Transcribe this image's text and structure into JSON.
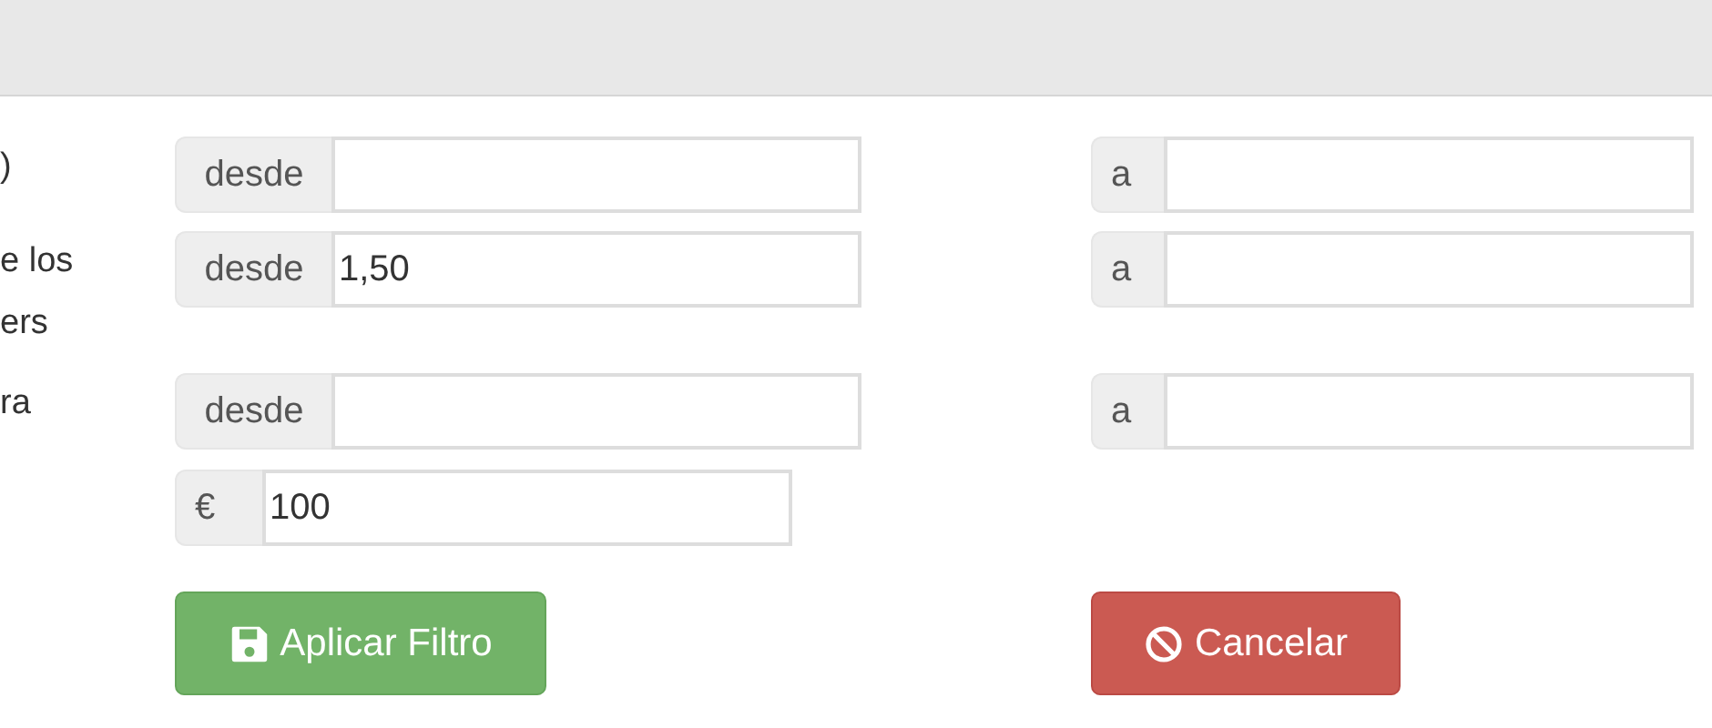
{
  "rows": [
    {
      "kind": "range",
      "label_lines": [
        ")"
      ],
      "from": {
        "addon": "desde"
      },
      "to": {
        "addon": "a"
      }
    },
    {
      "kind": "range",
      "label_lines": [
        "e los",
        "ers"
      ],
      "from": {
        "addon": "desde",
        "value": "1,50"
      },
      "to": {
        "addon": "a"
      }
    },
    {
      "kind": "range",
      "label_lines": [
        "ra"
      ],
      "from": {
        "addon": "desde"
      },
      "to": {
        "addon": "a"
      }
    },
    {
      "kind": "amount",
      "field": {
        "addon": "€",
        "value": "100"
      }
    }
  ],
  "buttons": [
    {
      "kind": "apply",
      "label": "Aplicar Filtro"
    },
    {
      "kind": "cancel",
      "label": "Cancelar"
    }
  ]
}
